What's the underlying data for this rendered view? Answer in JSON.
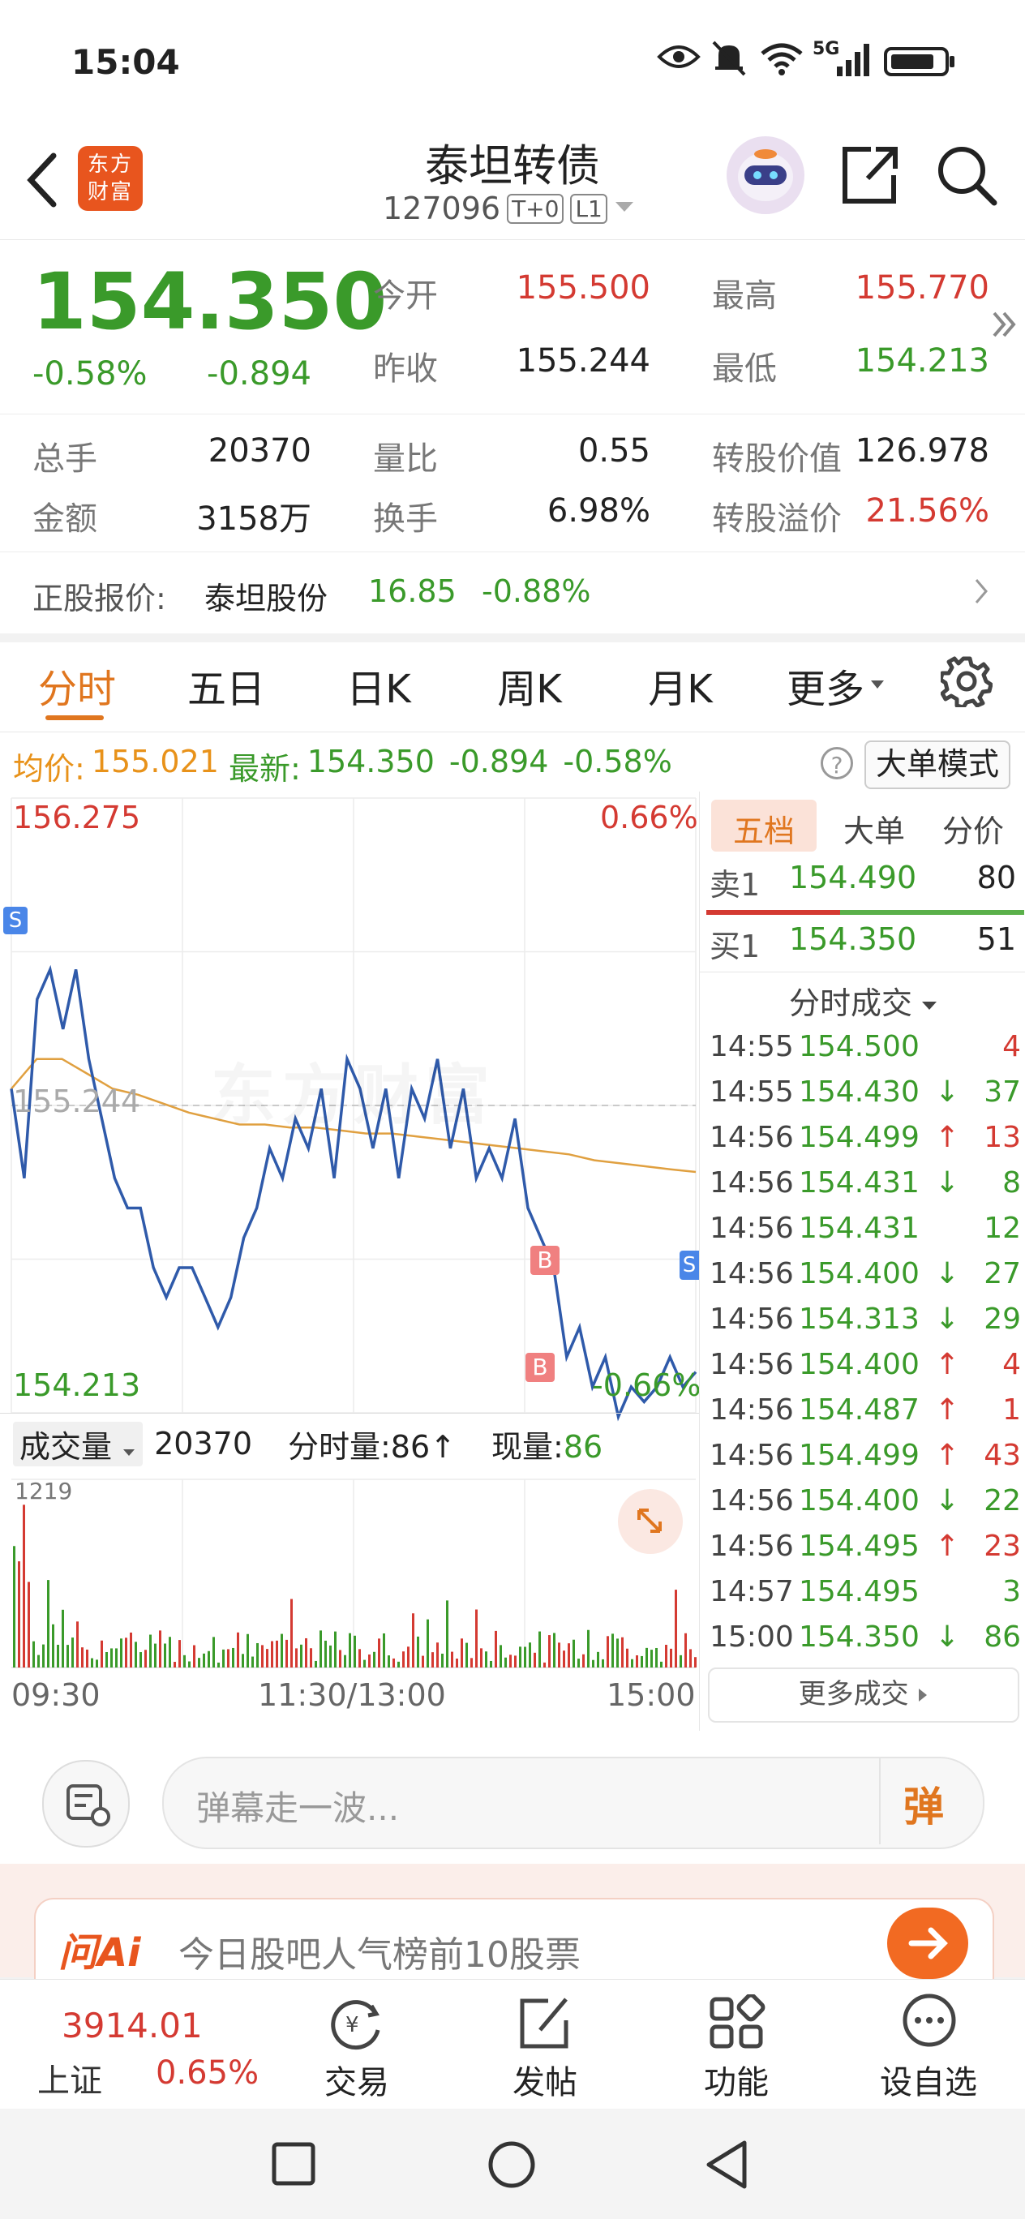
{
  "status_bar": {
    "time": "15:04",
    "network": "5G"
  },
  "header": {
    "back_icon": "chevron-left-icon",
    "logo_text": "东方财富",
    "title": "泰坦转债",
    "code": "127096",
    "badge_t0": "T+0",
    "badge_level": "L1",
    "actions": [
      "robot-avatar",
      "share-icon",
      "search-icon"
    ]
  },
  "quote": {
    "price": "154.350",
    "change_pct": "-0.58%",
    "change_abs": "-0.894",
    "open_label": "今开",
    "open": "155.500",
    "high_label": "最高",
    "high": "155.770",
    "prev_close_label": "昨收",
    "prev_close": "155.244",
    "low_label": "最低",
    "low": "154.213"
  },
  "stats": {
    "volume_label": "总手",
    "volume": "20370",
    "vol_ratio_label": "量比",
    "vol_ratio": "0.55",
    "conv_value_label": "转股价值",
    "conv_value": "126.978",
    "amount_label": "金额",
    "amount": "3158万",
    "turnover_label": "换手",
    "turnover": "6.98%",
    "premium_label": "转股溢价",
    "premium": "21.56%"
  },
  "underlying": {
    "label": "正股报价:",
    "name": "泰坦股份",
    "price": "16.85",
    "change": "-0.88%"
  },
  "tabs": [
    "分时",
    "五日",
    "日K",
    "周K",
    "月K",
    "更多"
  ],
  "active_tab": "分时",
  "info_bar": {
    "avg_label": "均价:",
    "avg": "155.021",
    "latest_label": "最新:",
    "latest": "154.350",
    "chg": "-0.894",
    "pct": "-0.58%",
    "mode_button": "大单模式"
  },
  "chart": {
    "top_left": "156.275",
    "top_right": "0.66%",
    "mid_label": "155.244",
    "bottom_left": "154.213",
    "bottom_right": "-0.66%",
    "watermark": "东方财富",
    "markers": [
      "S",
      "B",
      "B",
      "S"
    ],
    "volume_label": "成交量",
    "volume_total": "20370",
    "min_vol_label": "分时量:86↑",
    "now_vol_label": "现量:",
    "now_vol": "86",
    "vol_max": "1219",
    "time_labels": [
      "09:30",
      "11:30/13:00",
      "15:00"
    ]
  },
  "chart_data": {
    "type": "line",
    "x_range": [
      "09:30",
      "15:00"
    ],
    "ylim": [
      154.213,
      156.275
    ],
    "reference_line": 155.244,
    "series": [
      {
        "name": "价格",
        "values": [
          155.3,
          155.0,
          155.6,
          155.7,
          155.5,
          155.7,
          155.4,
          155.2,
          155.0,
          154.9,
          154.9,
          154.7,
          154.6,
          154.7,
          154.7,
          154.6,
          154.5,
          154.6,
          154.8,
          154.9,
          155.1,
          155.0,
          155.2,
          155.1,
          155.3,
          155.0,
          155.4,
          155.3,
          155.1,
          155.3,
          155.0,
          155.3,
          155.2,
          155.4,
          155.1,
          155.3,
          155.0,
          155.1,
          155.0,
          155.2,
          154.9,
          154.8,
          154.7,
          154.4,
          154.5,
          154.3,
          154.4,
          154.2,
          154.3,
          154.25,
          154.3,
          154.4,
          154.3,
          154.35
        ]
      },
      {
        "name": "均价",
        "values": [
          155.3,
          155.4,
          155.4,
          155.35,
          155.3,
          155.28,
          155.25,
          155.22,
          155.2,
          155.18,
          155.18,
          155.17,
          155.17,
          155.16,
          155.15,
          155.15,
          155.14,
          155.13,
          155.12,
          155.11,
          155.1,
          155.09,
          155.08,
          155.06,
          155.05,
          155.04,
          155.03,
          155.021
        ]
      }
    ]
  },
  "side_panel": {
    "tabs": [
      "五档",
      "大单",
      "分价"
    ],
    "active_tab": "五档",
    "sell1_label": "卖1",
    "sell1_price": "154.490",
    "sell1_vol": "80",
    "buy1_label": "买1",
    "buy1_price": "154.350",
    "buy1_vol": "51",
    "trades_title": "分时成交",
    "trades": [
      {
        "time": "14:55",
        "price": "154.500",
        "arrow": "",
        "vol": "4",
        "color": "red"
      },
      {
        "time": "14:55",
        "price": "154.430",
        "arrow": "↓",
        "vol": "37",
        "color": "green"
      },
      {
        "time": "14:56",
        "price": "154.499",
        "arrow": "↑",
        "vol": "13",
        "color": "red"
      },
      {
        "time": "14:56",
        "price": "154.431",
        "arrow": "↓",
        "vol": "8",
        "color": "green"
      },
      {
        "time": "14:56",
        "price": "154.431",
        "arrow": "",
        "vol": "12",
        "color": "green"
      },
      {
        "time": "14:56",
        "price": "154.400",
        "arrow": "↓",
        "vol": "27",
        "color": "green"
      },
      {
        "time": "14:56",
        "price": "154.313",
        "arrow": "↓",
        "vol": "29",
        "color": "green"
      },
      {
        "time": "14:56",
        "price": "154.400",
        "arrow": "↑",
        "vol": "4",
        "color": "red"
      },
      {
        "time": "14:56",
        "price": "154.487",
        "arrow": "↑",
        "vol": "1",
        "color": "red"
      },
      {
        "time": "14:56",
        "price": "154.499",
        "arrow": "↑",
        "vol": "43",
        "color": "red"
      },
      {
        "time": "14:56",
        "price": "154.400",
        "arrow": "↓",
        "vol": "22",
        "color": "green"
      },
      {
        "time": "14:56",
        "price": "154.495",
        "arrow": "↑",
        "vol": "23",
        "color": "red"
      },
      {
        "time": "14:57",
        "price": "154.495",
        "arrow": "",
        "vol": "3",
        "color": "green"
      },
      {
        "time": "15:00",
        "price": "154.350",
        "arrow": "↓",
        "vol": "86",
        "color": "green"
      }
    ],
    "more_trades": "更多成交"
  },
  "comment_bar": {
    "placeholder": "弹幕走一波...",
    "danmu_button": "弹"
  },
  "ai_banner": {
    "logo": "问Ai",
    "text": "今日股吧人气榜前10股票"
  },
  "bottom_nav": {
    "index_value": "3914.01",
    "index_name": "上证",
    "index_pct": "0.65%",
    "items": [
      "交易",
      "发帖",
      "功能",
      "设自选"
    ]
  }
}
